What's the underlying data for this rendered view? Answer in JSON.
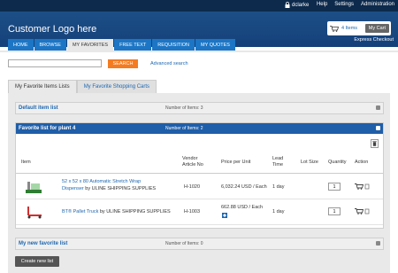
{
  "topbar": {
    "username": "dclarke",
    "links": [
      "Help",
      "Settings",
      "Administration"
    ]
  },
  "header": {
    "logo": "Customer Logo here",
    "cart_items": "4 Items",
    "cart_button": "My Cart",
    "express_checkout": "Express Checkout"
  },
  "nav": {
    "tabs": [
      "HOME",
      "BROWSE",
      "MY FAVORITES",
      "FREE TEXT",
      "REQUISITION",
      "MY QUOTES"
    ],
    "active": "MY FAVORITES"
  },
  "search": {
    "value": "",
    "button": "SEARCH",
    "advanced": "Advanced search"
  },
  "page_tabs": [
    "My Favorite Items Lists",
    "My Favorite Shopping Carts"
  ],
  "lists": [
    {
      "name": "Default item list",
      "count": "Number of Items: 3"
    },
    {
      "name": "Favorite list for plant 4",
      "count": "Number of Items: 2"
    },
    {
      "name": "My new favorite list",
      "count": "Number of Items: 0"
    }
  ],
  "table": {
    "headers": {
      "item": "Item",
      "vendor": "Vendor",
      "vendor2": "Article No",
      "price": "Price per Unit",
      "lead": "Lead",
      "lead2": "Time",
      "lot": "Lot Size",
      "qty": "Quantity",
      "action": "Action"
    },
    "rows": [
      {
        "title": "52 x 52 x 80 Automatic Stretch Wrap",
        "title2": "Dispenser",
        "by": "by ULINE SHIPPING SUPPLIES",
        "article": "H-1020",
        "price": "6,032.24 USD / Each",
        "lead": "1 day",
        "qty": "1"
      },
      {
        "title": "BT® Pallet Truck",
        "title2": "",
        "by": "by ULINE SHIPPING SUPPLIES",
        "article": "H-1003",
        "price": "662.88 USD / Each",
        "lead": "1 day",
        "qty": "1"
      }
    ]
  },
  "create_button": "Create new list",
  "colors": {
    "header": "#15407a",
    "nav_tab": "#1c76c5",
    "search_button": "#f47b20",
    "panel_blue": "#1f5ea8"
  }
}
